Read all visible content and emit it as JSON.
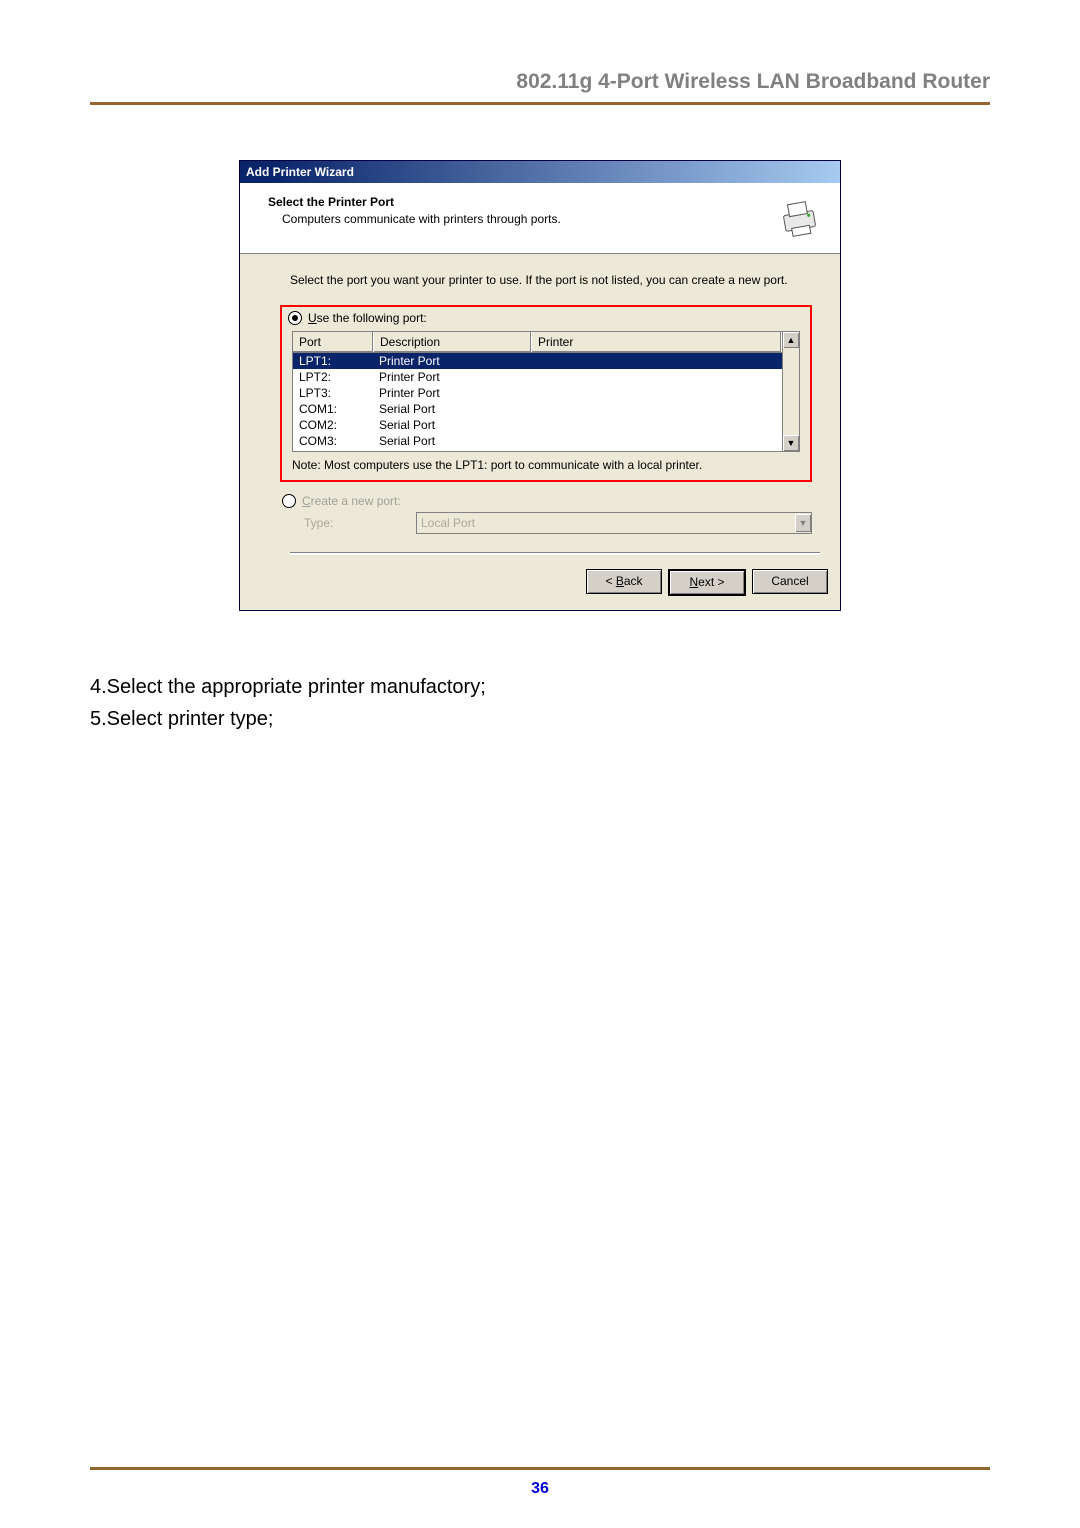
{
  "header": {
    "title": "802.11g 4-Port Wireless LAN Broadband Router"
  },
  "dialog": {
    "titlebar": "Add Printer Wizard",
    "heading": "Select the Printer Port",
    "subheading": "Computers communicate with printers through ports.",
    "instruction": "Select the port you want your printer to use.  If the port is not listed, you can create a new port.",
    "radio_use": {
      "prefix": "U",
      "rest": "se the following port:"
    },
    "list": {
      "headers": {
        "port": "Port",
        "desc": "Description",
        "printer": "Printer"
      },
      "rows": [
        {
          "port": "LPT1:",
          "desc": "Printer Port",
          "printer": "",
          "selected": true
        },
        {
          "port": "LPT2:",
          "desc": "Printer Port",
          "printer": ""
        },
        {
          "port": "LPT3:",
          "desc": "Printer Port",
          "printer": ""
        },
        {
          "port": "COM1:",
          "desc": "Serial Port",
          "printer": ""
        },
        {
          "port": "COM2:",
          "desc": "Serial Port",
          "printer": ""
        },
        {
          "port": "COM3:",
          "desc": "Serial Port",
          "printer": ""
        }
      ]
    },
    "note": "Note: Most computers use the LPT1: port to communicate with a local printer.",
    "radio_create": {
      "prefix": "C",
      "rest": "reate a new port:"
    },
    "type_label": "Type:",
    "type_value": "Local Port",
    "buttons": {
      "back": {
        "lt": "< ",
        "u": "B",
        "rest": "ack"
      },
      "next": {
        "u": "N",
        "rest": "ext >"
      },
      "cancel": "Cancel"
    }
  },
  "document": {
    "step4": "4.Select the appropriate printer manufactory;",
    "step5": "5.Select printer type;"
  },
  "footer": {
    "pagenum": "36"
  }
}
